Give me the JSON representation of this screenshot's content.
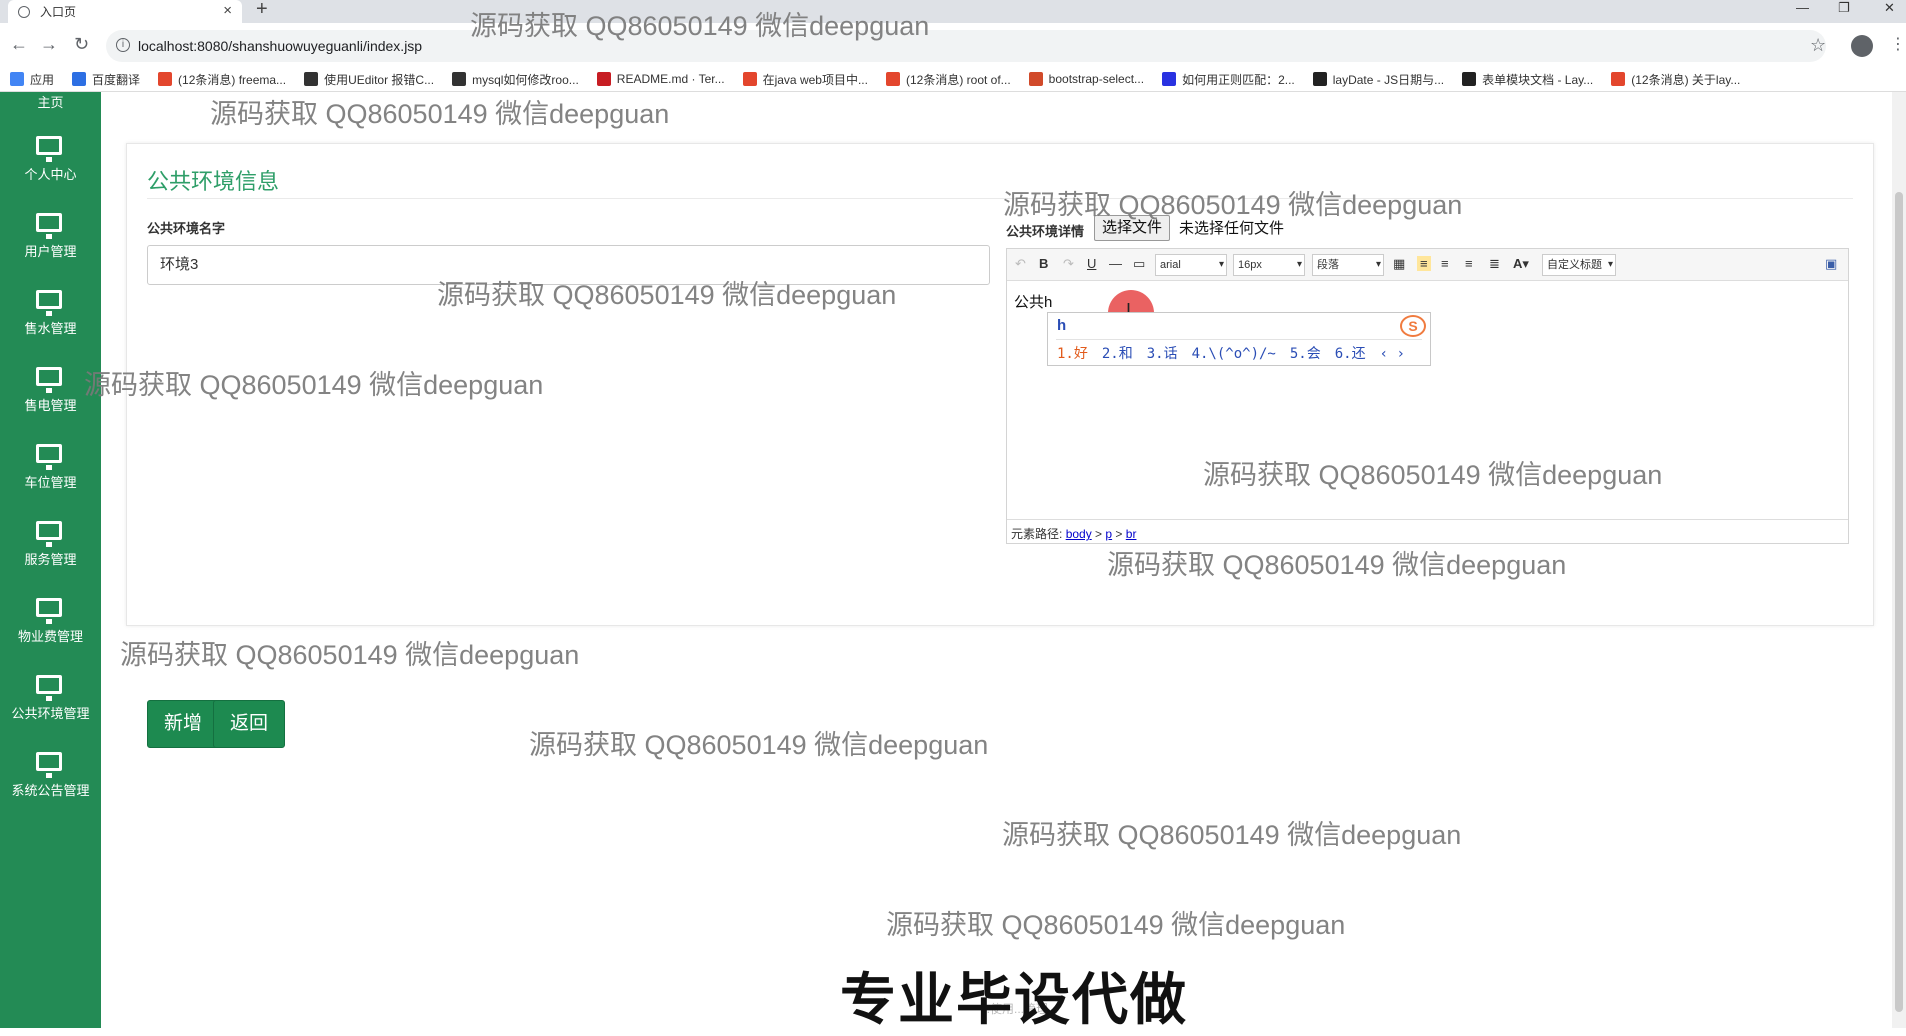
{
  "browser": {
    "tab_title": "入口页",
    "url": "localhost:8080/shanshuowuyeguanli/index.jsp",
    "bookmarks": [
      {
        "label": "应用",
        "color": "#4285f4"
      },
      {
        "label": "百度翻译",
        "color": "#2d6fe3"
      },
      {
        "label": "(12条消息) freema...",
        "color": "#e3462d"
      },
      {
        "label": "使用UEditor 报错C...",
        "color": "#333333"
      },
      {
        "label": "mysql如何修改roo...",
        "color": "#333333"
      },
      {
        "label": "README.md · Ter...",
        "color": "#c71d23"
      },
      {
        "label": "在java web项目中...",
        "color": "#e3462d"
      },
      {
        "label": "(12条消息) root of...",
        "color": "#e3462d"
      },
      {
        "label": "bootstrap-select...",
        "color": "#d14a2a"
      },
      {
        "label": "如何用正则匹配：2...",
        "color": "#2932e1"
      },
      {
        "label": "layDate - JS日期与...",
        "color": "#222222"
      },
      {
        "label": "表单模块文档 - Lay...",
        "color": "#222222"
      },
      {
        "label": "(12条消息) 关于lay...",
        "color": "#e3462d"
      }
    ]
  },
  "sidebar": {
    "top_partial": "主页",
    "items": [
      {
        "label": "个人中心"
      },
      {
        "label": "用户管理"
      },
      {
        "label": "售水管理"
      },
      {
        "label": "售电管理"
      },
      {
        "label": "车位管理"
      },
      {
        "label": "服务管理"
      },
      {
        "label": "物业费管理"
      },
      {
        "label": "公共环境管理"
      },
      {
        "label": "系统公告管理"
      }
    ]
  },
  "form": {
    "title": "公共环境信息",
    "name_label": "公共环境名字",
    "name_value": "环境3",
    "detail_label": "公共环境详情",
    "file_button": "选择文件",
    "file_status": "未选择任何文件",
    "editor": {
      "font": "arial",
      "size": "16px",
      "paragraph": "段落",
      "custom_title": "自定义标题",
      "content": "公共h",
      "path_label": "元素路径:",
      "path": [
        "body",
        "p",
        "br"
      ]
    },
    "ime": {
      "pinyin": "h",
      "candidates": [
        "1.好",
        "2.和",
        "3.话",
        "4.\\(^o^)/~",
        "5.会",
        "6.还"
      ]
    },
    "add_button": "新增",
    "back_button": "返回"
  },
  "watermark": "源码获取 QQ86050149 微信deepguan",
  "promo_text": "专业毕设代做",
  "footer_faint": "...使用...管理..."
}
